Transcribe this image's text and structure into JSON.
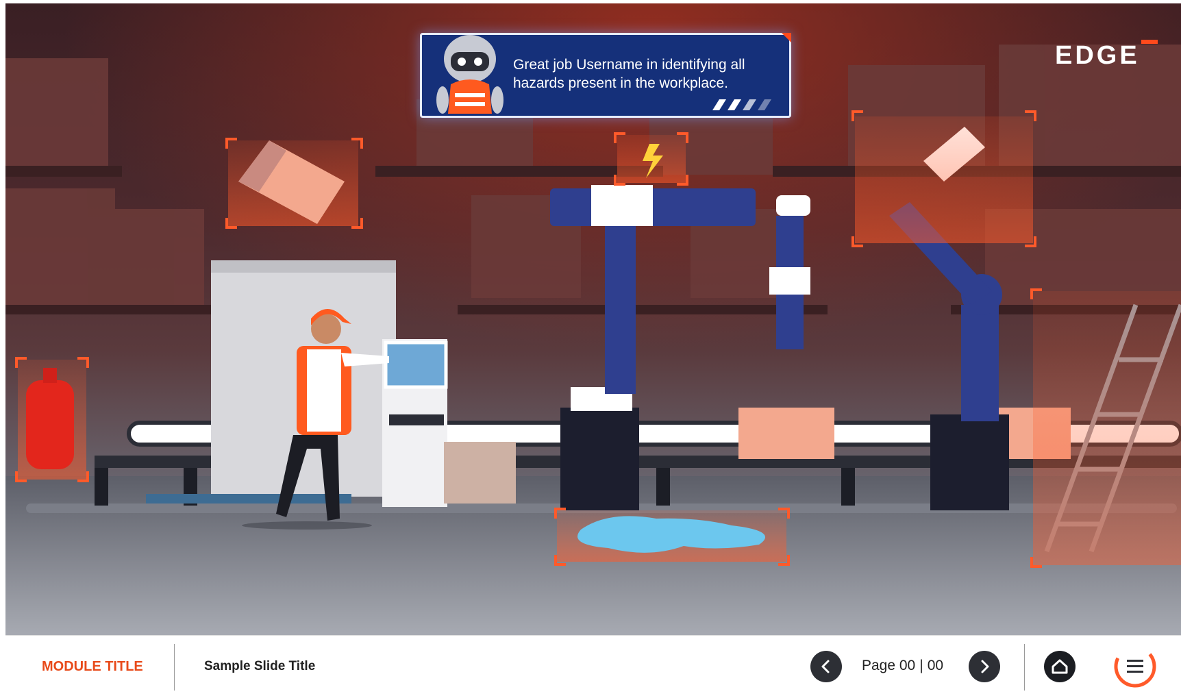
{
  "toast": {
    "message": "Great job Username in identifying all hazards present in the workplace."
  },
  "logo": {
    "text": "EDGE"
  },
  "scene": {
    "hazards": [
      "falling-box",
      "electrical-spark",
      "robot-arm-motion",
      "gas-cylinder",
      "water-spill",
      "ladder"
    ]
  },
  "footer": {
    "module_title": "MODULE TITLE",
    "slide_title": "Sample Slide Title",
    "page_label": "Page 00",
    "page_separator": "|",
    "page_total": "00"
  },
  "colors": {
    "accent": "#e84a1a",
    "toast_bg": "#15307a",
    "robot_blue": "#2f3f8f",
    "highlight": "#ff5a2a"
  }
}
